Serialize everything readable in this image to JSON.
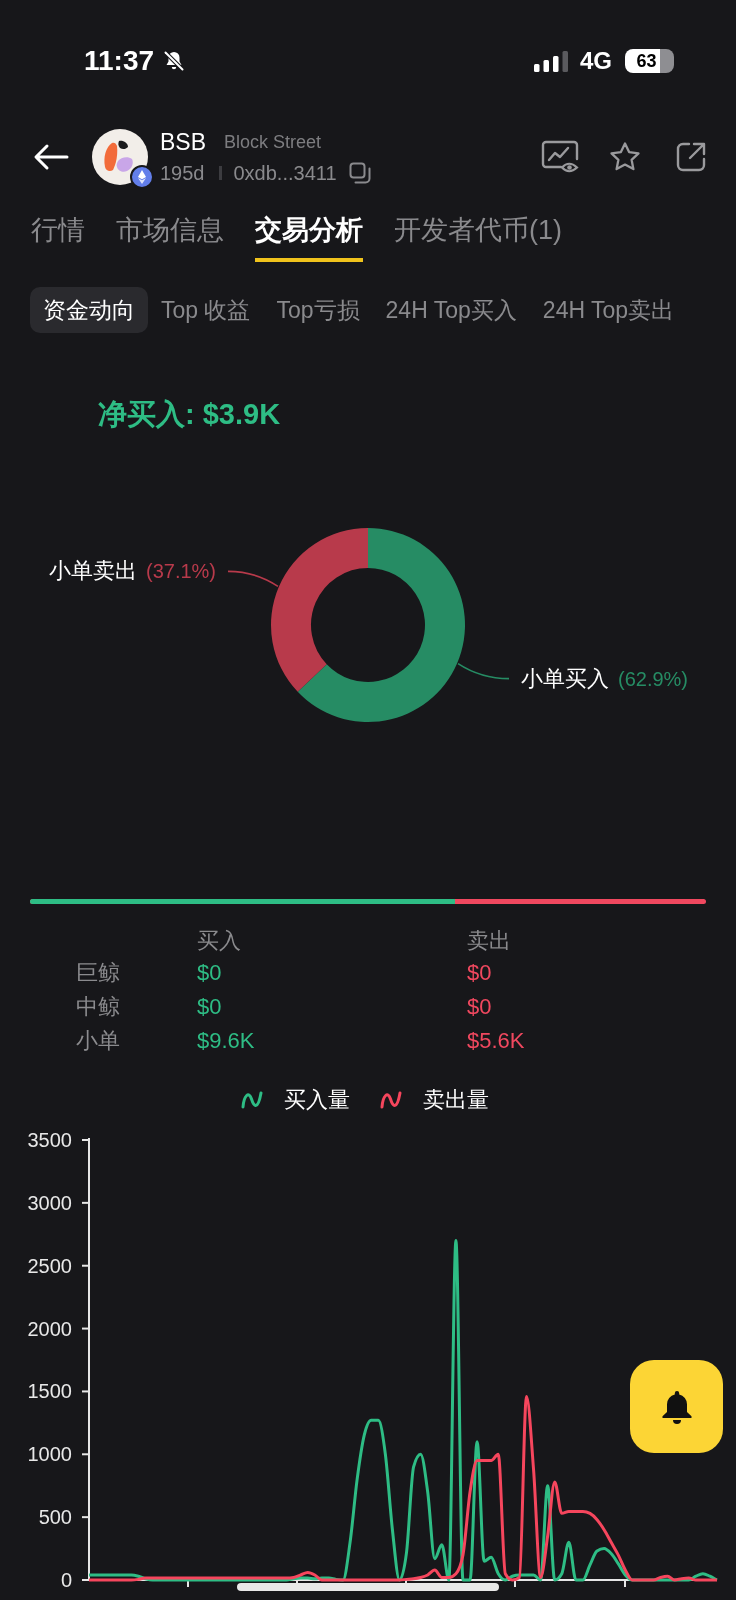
{
  "status_bar": {
    "time": "11:37",
    "network": "4G",
    "battery": "63"
  },
  "header": {
    "symbol": "BSB",
    "name": "Block Street",
    "age": "195d",
    "address": "0xdb...3411"
  },
  "tabs": [
    {
      "label": "行情",
      "selected": false
    },
    {
      "label": "市场信息",
      "selected": false
    },
    {
      "label": "交易分析",
      "selected": true
    },
    {
      "label": "开发者代币(1)",
      "selected": false
    }
  ],
  "subtabs": [
    {
      "label": "资金动向",
      "selected": true
    },
    {
      "label": "Top 收益",
      "selected": false
    },
    {
      "label": "Top亏损",
      "selected": false
    },
    {
      "label": "24H Top买入",
      "selected": false
    },
    {
      "label": "24H Top卖出",
      "selected": false
    }
  ],
  "net_buy": "净买入: $3.9K",
  "flow_chart": {
    "chart_data": {
      "type": "donut",
      "categories": [
        "小单买入",
        "小单卖出"
      ],
      "values": [
        62.9,
        37.1
      ],
      "colors": [
        "#268c64",
        "#b83a4b"
      ],
      "value_labels": [
        "(62.9%)",
        "(37.1%)"
      ]
    }
  },
  "balance_bar": {
    "level": 0.629
  },
  "orders_table": {
    "columns": [
      "买入",
      "卖出"
    ],
    "rows": [
      {
        "label": "巨鲸",
        "cells": [
          "$0",
          "$0"
        ]
      },
      {
        "label": "中鲸",
        "cells": [
          "$0",
          "$0"
        ]
      },
      {
        "label": "小单",
        "cells": [
          "$9.6K",
          "$5.6K"
        ]
      }
    ]
  },
  "volume_chart": {
    "chart_data": {
      "type": "line",
      "ylim": [
        0,
        3500
      ],
      "yticks": [
        0,
        500,
        1000,
        1500,
        2000,
        2500,
        3000,
        3500
      ],
      "series": [
        {
          "name": "买入量",
          "color": "#2ebd85",
          "values": [
            40,
            40,
            40,
            40,
            40,
            40,
            40,
            30,
            10,
            0,
            0,
            0,
            0,
            0,
            0,
            0,
            0,
            0,
            0,
            0,
            0,
            0,
            0,
            0,
            0,
            0,
            0,
            0,
            0,
            10,
            15,
            15,
            10,
            15,
            15,
            5,
            0,
            300,
            800,
            1150,
            1270,
            1270,
            1000,
            400,
            0,
            220,
            900,
            1000,
            700,
            170,
            280,
            0,
            2700,
            0,
            0,
            1100,
            150,
            180,
            50,
            0,
            30,
            40,
            40,
            40,
            0,
            750,
            0,
            50,
            300,
            0,
            0,
            120,
            230,
            250,
            210,
            130,
            40,
            0,
            0,
            0,
            0,
            0,
            0,
            0,
            0,
            0,
            30,
            50,
            30,
            0
          ]
        },
        {
          "name": "卖出量",
          "color": "#f6465d",
          "values": [
            0,
            0,
            0,
            0,
            0,
            0,
            0,
            5,
            15,
            15,
            15,
            15,
            15,
            15,
            15,
            15,
            15,
            15,
            15,
            15,
            15,
            15,
            15,
            15,
            15,
            15,
            15,
            15,
            15,
            20,
            40,
            60,
            40,
            0,
            0,
            0,
            0,
            0,
            0,
            0,
            0,
            0,
            0,
            0,
            0,
            5,
            10,
            20,
            40,
            80,
            20,
            20,
            50,
            200,
            700,
            950,
            950,
            950,
            1000,
            50,
            0,
            20,
            1460,
            880,
            20,
            350,
            780,
            530,
            545,
            545,
            545,
            530,
            480,
            400,
            300,
            200,
            80,
            0,
            0,
            0,
            0,
            20,
            30,
            0,
            10,
            15,
            0,
            0,
            0,
            0
          ]
        }
      ]
    }
  }
}
